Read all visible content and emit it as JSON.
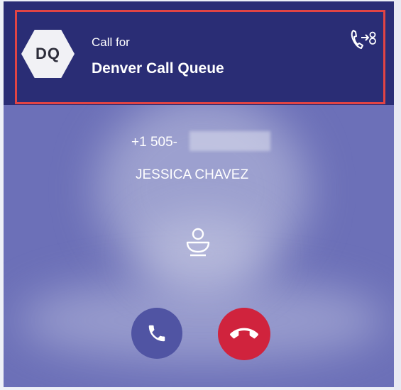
{
  "header": {
    "avatar_initials": "DQ",
    "call_for_label": "Call for",
    "queue_name": "Denver Call Queue",
    "transfer_icon": "call-transfer-icon"
  },
  "caller": {
    "phone_number": "+1 505-",
    "name": "JESSICA CHAVEZ",
    "caller_icon": "person-icon"
  },
  "actions": {
    "accept_icon": "phone-icon",
    "decline_icon": "hang-up-icon"
  },
  "colors": {
    "header_bg": "#2a2d75",
    "card_bg": "#6c70b8",
    "highlight_border": "#e24444",
    "accept_bg": "#5054a3",
    "decline_bg": "#d0233d"
  }
}
